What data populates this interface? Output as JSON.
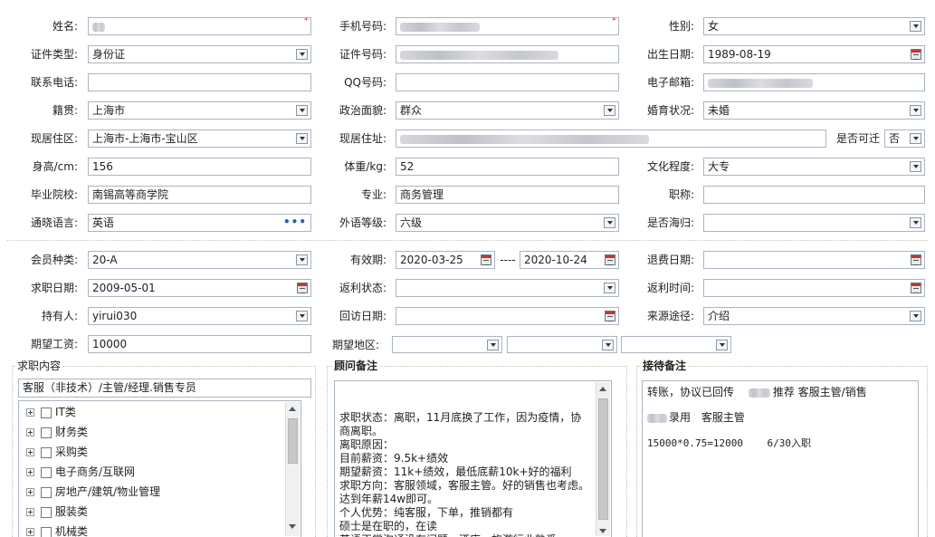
{
  "form": {
    "name": {
      "label": "姓名:",
      "required": "*"
    },
    "phone": {
      "label": "手机号码:",
      "required": "*"
    },
    "gender": {
      "label": "性别:",
      "value": "女"
    },
    "id_type": {
      "label": "证件类型:",
      "value": "身份证"
    },
    "id_number": {
      "label": "证件号码:"
    },
    "birth_date": {
      "label": "出生日期:",
      "value": "1989-08-19"
    },
    "contact_phone": {
      "label": "联系电话:",
      "value": ""
    },
    "qq": {
      "label": "QQ号码:",
      "value": ""
    },
    "email": {
      "label": "电子邮箱:"
    },
    "native_place": {
      "label": "籍贯:",
      "value": "上海市"
    },
    "political": {
      "label": "政治面貌:",
      "value": "群众"
    },
    "marital": {
      "label": "婚育状况:",
      "value": "未婚"
    },
    "residence_area": {
      "label": "现居住区:",
      "value": "上海市-上海市-宝山区"
    },
    "residence_addr": {
      "label": "现居住址:"
    },
    "relocate": {
      "label": "是否可迁",
      "value": "否"
    },
    "height": {
      "label": "身高/cm:",
      "value": "156"
    },
    "weight": {
      "label": "体重/kg:",
      "value": "52"
    },
    "education": {
      "label": "文化程度:",
      "value": "大专"
    },
    "school": {
      "label": "毕业院校:",
      "value": "南锡高等商学院"
    },
    "major": {
      "label": "专业:",
      "value": "商务管理"
    },
    "title": {
      "label": "职称:",
      "value": ""
    },
    "language": {
      "label": "通晓语言:",
      "value": "英语",
      "more": "•••"
    },
    "foreign_level": {
      "label": "外语等级:",
      "value": "六级"
    },
    "returnee": {
      "label": "是否海归:",
      "value": ""
    }
  },
  "membership": {
    "member_type": {
      "label": "会员种类:",
      "value": "20-A"
    },
    "validity": {
      "label": "有效期:",
      "start": "2020-03-25",
      "sep": "----",
      "end": "2020-10-24"
    },
    "refund_date": {
      "label": "退费日期:",
      "value": ""
    },
    "job_date": {
      "label": "求职日期:",
      "value": "2009-05-01"
    },
    "rebate_status": {
      "label": "返利状态:",
      "value": ""
    },
    "rebate_time": {
      "label": "返利时间:",
      "value": ""
    },
    "holder": {
      "label": "持有人:",
      "value": "yirui030"
    },
    "visit_date": {
      "label": "回访日期:",
      "value": ""
    },
    "source": {
      "label": "来源途径:",
      "value": "介绍"
    },
    "salary": {
      "label": "期望工资:",
      "value": "10000"
    },
    "region": {
      "label": "期望地区:"
    }
  },
  "job_content": {
    "title": "求职内容",
    "summary": "客服（非技术）/主管/经理.销售专员",
    "categories": [
      "IT类",
      "财务类",
      "采购类",
      "电子商务/互联网",
      "房地产/建筑/物业管理",
      "服装类",
      "机械类"
    ]
  },
  "consultant_notes": {
    "title": "顾问备注",
    "text": "求职状态：离职，11月底换了工作，因为疫情，协商离职。\n离职原因：\n目前薪资：9.5k+绩效\n期望薪资：11k+绩效，最低底薪10k+好的福利\n求职方向：客服领域，客服主管。好的销售也考虑。\n达到年薪14w即可。\n个人优势：纯客服，下单，推销都有\n硕士是在职的，在读\n英语正常沟通没有问题，酒店，旅游行业熟悉。\n旅游，珠宝，支付三个行业熟悉，其他的也不排斥。"
  },
  "reception_notes": {
    "title": "接待备注",
    "line1a": "转账，协议已回传",
    "line1b": "推荐 客服主管/销售",
    "line2a": "录用",
    "line2b": "客服主管",
    "line3": "15000*0.75=12000    6/30入职"
  }
}
